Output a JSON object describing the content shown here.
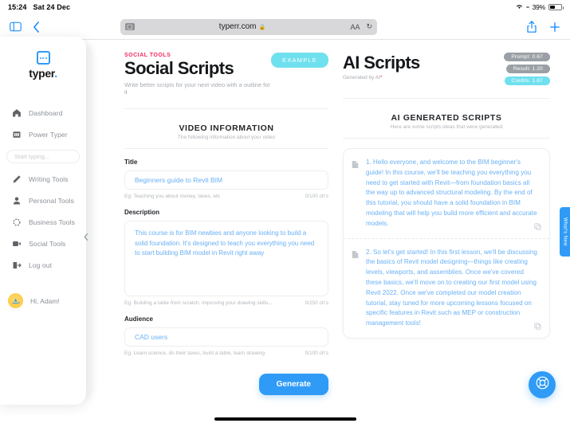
{
  "statusbar": {
    "time": "15:24",
    "date": "Sat 24 Dec",
    "battery_percent": "39%",
    "charge_label": "",
    "wifi_icon": "wifi-icon"
  },
  "browser": {
    "sidebar_toggle_icon": "sidebar-toggle-icon",
    "back_icon": "back-chevron-icon",
    "url": "typerr.com",
    "lock_icon": "lock-icon",
    "reader_icon": "reader-view-icon",
    "text_size_label": "AA",
    "reload_icon": "reload-icon",
    "share_icon": "share-icon",
    "new_tab_icon": "plus-icon",
    "tab_overflow_icon": "ellipsis-icon"
  },
  "sidebar": {
    "logo_text": "typer",
    "logo_dot": ".",
    "search_placeholder": "Start typing...",
    "search_value": "",
    "items": [
      {
        "label": "Dashboard",
        "icon": "home-icon"
      },
      {
        "label": "Power Typer",
        "icon": "bank-icon"
      },
      {
        "label": "Writing Tools",
        "icon": "pencil-icon"
      },
      {
        "label": "Personal Tools",
        "icon": "person-icon"
      },
      {
        "label": "Business Tools",
        "icon": "business-icon"
      },
      {
        "label": "Social Tools",
        "icon": "video-icon"
      },
      {
        "label": "Log out",
        "icon": "logout-icon"
      }
    ],
    "user_greeting": "Hi, Adam!",
    "collapse_icon": "collapse-chevron-icon"
  },
  "left_panel": {
    "eyebrow": "SOCIAL TOOLS",
    "title": "Social Scripts",
    "subtitle": "Write better scripts for your next video with a outline for it",
    "example_button": "EXAMPLE",
    "section_title": "VIDEO INFORMATION",
    "section_sub": "The following information about your video",
    "fields": [
      {
        "label": "Title",
        "value": "Beginners guide to Revit BIM",
        "hint": "Eg: Teaching you about money, taxes, etc",
        "counter": "0/100 ch's"
      },
      {
        "label": "Description",
        "value": "This course is for BIM newbies and anyone looking to build a solid foundation. It's designed to teach you everything you need to start building BIM model in Revit right away",
        "hint": "Eg: Building a table from scratch, improving your drawing skills...",
        "counter": "0/250 ch's"
      },
      {
        "label": "Audience",
        "value": "CAD users",
        "hint": "Eg: Learn science, do their taxes, build a table, learn drawing",
        "counter": "0/100 ch's"
      }
    ],
    "generate_button": "Generate"
  },
  "right_panel": {
    "title": "AI Scripts",
    "subtitle": "Generated by AI",
    "required_marker": "*",
    "badges": [
      {
        "label": "Prompt: 0.67",
        "style": "grey",
        "color": "#9ba0a6"
      },
      {
        "label": "Result: 1.20",
        "style": "grey",
        "color": "#9ba0a6"
      },
      {
        "label": "Credits: 1.87",
        "style": "cyan",
        "color": "#6fe0ee"
      }
    ],
    "section_title": "AI GENERATED SCRIPTS",
    "section_sub": "Here are some scripts ideas that were generated",
    "results": [
      {
        "doc_icon": "document-icon",
        "copy_icon": "copy-icon",
        "text": "1. Hello everyone, and welcome to the BIM beginner's guide! In this course, we'll be teaching you everything you need to get started with Revit—from foundation basics all the way up to advanced structural modeling. By the end of this tutorial, you should have a solid foundation in BIM modeling that will help you build more efficient and accurate models."
      },
      {
        "doc_icon": "document-icon",
        "copy_icon": "copy-icon",
        "text": "2. So let's get started! In this first lesson, we'll be discussing the basics of Revit model designing—things like creating levels, viewports, and assemblies. Once we've covered these basics, we'll move on to creating our first model using Revit 2022. Once we've completed our model creation tutorial, stay tuned for more upcoming lessons focused on specific features in Revit such as MEP or construction management tools!"
      }
    ]
  },
  "whats_new": {
    "label": "What's New"
  },
  "help_fab": {
    "icon": "lifebuoy-icon"
  },
  "colors": {
    "accent_blue": "#2f9bf6",
    "accent_cyan": "#6fe0ee",
    "accent_pink": "#f2295b",
    "text_blue": "#69b0f5",
    "muted": "#a6abb1"
  }
}
